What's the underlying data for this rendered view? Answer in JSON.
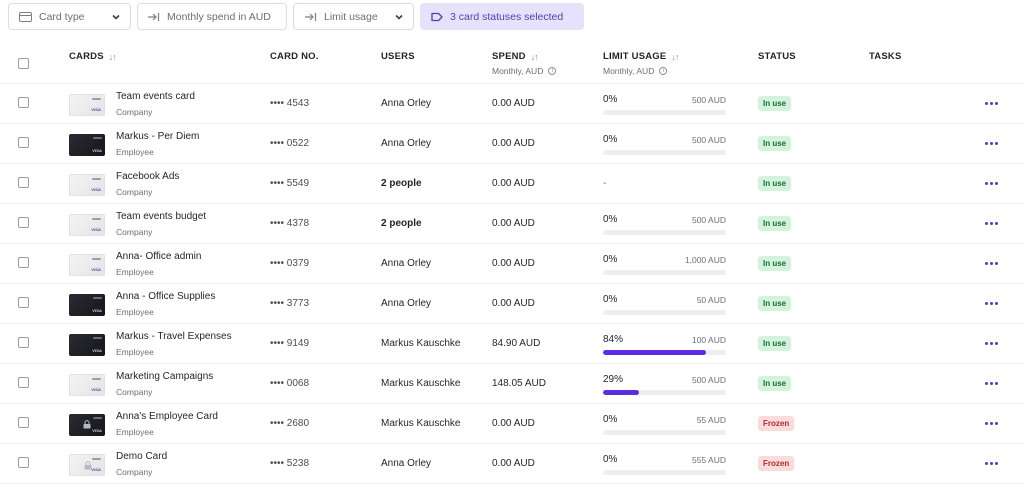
{
  "filters": {
    "card_type": "Card type",
    "monthly_spend": "Monthly spend in AUD",
    "limit_usage": "Limit usage",
    "status": "3 card statuses selected"
  },
  "columns": {
    "cards": "CARDS",
    "card_no": "CARD NO.",
    "users": "USERS",
    "spend": "SPEND",
    "spend_sub": "Monthly, AUD",
    "limit_usage": "LIMIT USAGE",
    "limit_usage_sub": "Monthly, AUD",
    "status": "STATUS",
    "tasks": "TASKS"
  },
  "colors": {
    "accent": "#5a2de0",
    "in_use_bg": "#d3f3dd",
    "frozen_bg": "#fbdcdc"
  },
  "rows": [
    {
      "name": "Team events card",
      "type": "Company",
      "card_style": "light",
      "card_no": "•••• 4543",
      "users": "Anna Orley",
      "users_bold": false,
      "spend": "0.00 AUD",
      "limit_pct": "0%",
      "limit_max": "500 AUD",
      "limit_fraction": 0,
      "status": "In use",
      "status_kind": "inuse"
    },
    {
      "name": "Markus - Per Diem",
      "type": "Employee",
      "card_style": "dark",
      "card_no": "•••• 0522",
      "users": "Anna Orley",
      "users_bold": false,
      "spend": "0.00 AUD",
      "limit_pct": "0%",
      "limit_max": "500 AUD",
      "limit_fraction": 0,
      "status": "In use",
      "status_kind": "inuse"
    },
    {
      "name": "Facebook Ads",
      "type": "Company",
      "card_style": "light",
      "card_no": "•••• 5549",
      "users": "2 people",
      "users_bold": true,
      "spend": "0.00 AUD",
      "limit_pct": "-",
      "limit_max": "",
      "limit_fraction": null,
      "status": "In use",
      "status_kind": "inuse"
    },
    {
      "name": "Team events budget",
      "type": "Company",
      "card_style": "light",
      "card_no": "•••• 4378",
      "users": "2 people",
      "users_bold": true,
      "spend": "0.00 AUD",
      "limit_pct": "0%",
      "limit_max": "500 AUD",
      "limit_fraction": 0,
      "status": "In use",
      "status_kind": "inuse"
    },
    {
      "name": "Anna- Office admin",
      "type": "Employee",
      "card_style": "light",
      "card_no": "•••• 0379",
      "users": "Anna Orley",
      "users_bold": false,
      "spend": "0.00 AUD",
      "limit_pct": "0%",
      "limit_max": "1,000 AUD",
      "limit_fraction": 0,
      "status": "In use",
      "status_kind": "inuse"
    },
    {
      "name": "Anna - Office Supplies",
      "type": "Employee",
      "card_style": "dark",
      "card_no": "•••• 3773",
      "users": "Anna Orley",
      "users_bold": false,
      "spend": "0.00 AUD",
      "limit_pct": "0%",
      "limit_max": "50 AUD",
      "limit_fraction": 0,
      "status": "In use",
      "status_kind": "inuse"
    },
    {
      "name": "Markus - Travel Expenses",
      "type": "Employee",
      "card_style": "dark",
      "card_no": "•••• 9149",
      "users": "Markus Kauschke",
      "users_bold": false,
      "spend": "84.90 AUD",
      "limit_pct": "84%",
      "limit_max": "100 AUD",
      "limit_fraction": 0.84,
      "status": "In use",
      "status_kind": "inuse"
    },
    {
      "name": "Marketing Campaigns",
      "type": "Company",
      "card_style": "light",
      "card_no": "•••• 0068",
      "users": "Markus Kauschke",
      "users_bold": false,
      "spend": "148.05 AUD",
      "limit_pct": "29%",
      "limit_max": "500 AUD",
      "limit_fraction": 0.29,
      "status": "In use",
      "status_kind": "inuse"
    },
    {
      "name": "Anna's Employee Card",
      "type": "Employee",
      "card_style": "dark-locked",
      "card_no": "•••• 2680",
      "users": "Markus Kauschke",
      "users_bold": false,
      "spend": "0.00 AUD",
      "limit_pct": "0%",
      "limit_max": "55 AUD",
      "limit_fraction": 0,
      "status": "Frozen",
      "status_kind": "frozen"
    },
    {
      "name": "Demo Card",
      "type": "Company",
      "card_style": "light-locked",
      "card_no": "•••• 5238",
      "users": "Anna Orley",
      "users_bold": false,
      "spend": "0.00 AUD",
      "limit_pct": "0%",
      "limit_max": "555 AUD",
      "limit_fraction": 0,
      "status": "Frozen",
      "status_kind": "frozen"
    }
  ]
}
